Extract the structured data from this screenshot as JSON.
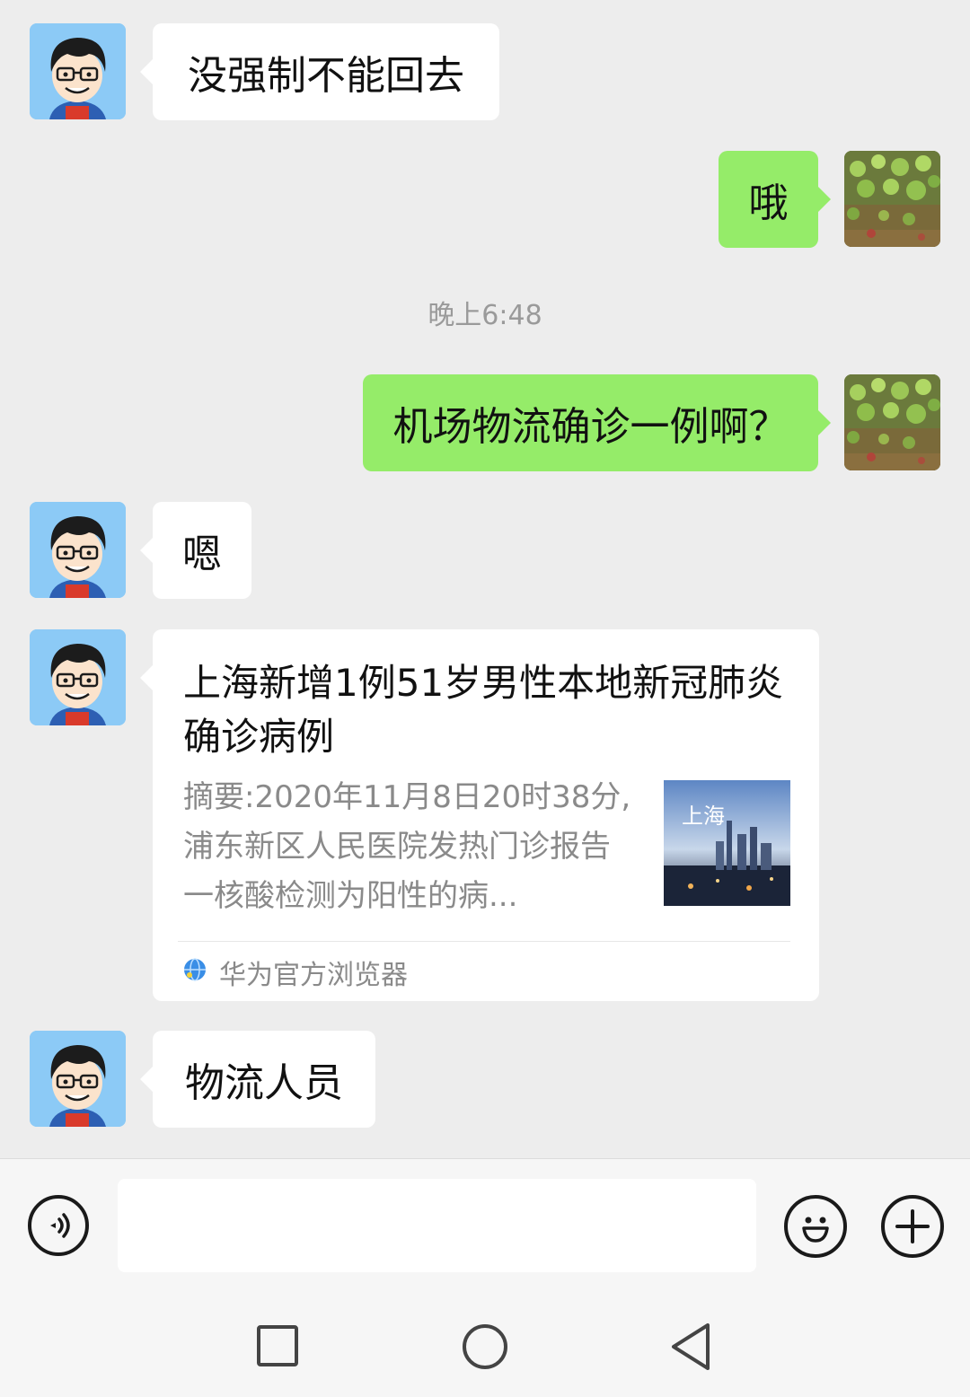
{
  "messages": [
    {
      "side": "in",
      "text": "没强制不能回去"
    },
    {
      "side": "out",
      "text": "哦"
    },
    {
      "side": "out",
      "text": "机场物流确诊一例啊？"
    },
    {
      "side": "in",
      "text": "嗯"
    },
    {
      "side": "in",
      "text": "物流人员"
    }
  ],
  "timestamp": "晚上6:48",
  "link_card": {
    "title": "上海新增1例51岁男性本地新冠肺炎确诊病例",
    "summary": "摘要:2020年11月8日20时38分,浦东新区人民医院发热门诊报告一核酸检测为阳性的病...",
    "source": "华为官方浏览器",
    "thumbnail_text": "上海"
  },
  "input_bar": {
    "voice_icon": "voice-icon",
    "emoji_icon": "emoji-icon",
    "plus_icon": "plus-icon"
  },
  "nav_bar": {
    "icons": [
      "recent-apps-icon",
      "home-icon",
      "back-icon"
    ]
  },
  "colors": {
    "background": "#ededed",
    "incoming_bubble": "#ffffff",
    "outgoing_bubble": "#95ec69",
    "friend_avatar_bg": "#8ccaf6"
  }
}
